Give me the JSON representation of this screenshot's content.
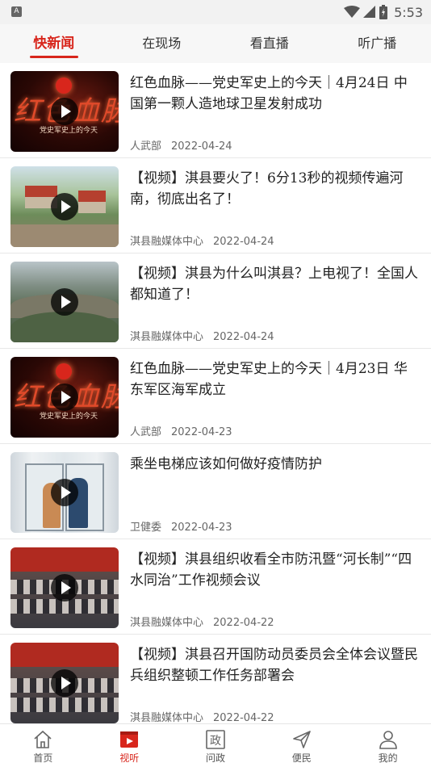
{
  "status_bar": {
    "left_icon": "A",
    "time": "5:53",
    "icons": [
      "wifi-icon",
      "signal-icon",
      "battery-icon"
    ]
  },
  "tabs": [
    {
      "label": "快新闻",
      "active": true
    },
    {
      "label": "在现场",
      "active": false
    },
    {
      "label": "看直播",
      "active": false
    },
    {
      "label": "听广播",
      "active": false
    }
  ],
  "news": [
    {
      "title": "红色血脉——党史军史上的今天｜4月24日 中国第一颗人造地球卫星发射成功",
      "source": "人武部",
      "date": "2022-04-24",
      "thumb_text": "红色血脉",
      "thumb_sub": "党史军史上的今天"
    },
    {
      "title": "【视频】淇县要火了！6分13秒的视频传遍河南，彻底出名了！",
      "source": "淇县融媒体中心",
      "date": "2022-04-24"
    },
    {
      "title": "【视频】淇县为什么叫淇县？上电视了！全国人都知道了！",
      "source": "淇县融媒体中心",
      "date": "2022-04-24"
    },
    {
      "title": "红色血脉——党史军史上的今天｜4月23日 华东军区海军成立",
      "source": "人武部",
      "date": "2022-04-23",
      "thumb_text": "红色血脉",
      "thumb_sub": "党史军史上的今天"
    },
    {
      "title": "乘坐电梯应该如何做好疫情防护",
      "source": "卫健委",
      "date": "2022-04-23"
    },
    {
      "title": "【视频】淇县组织收看全市防汛暨“河长制”“四水同治”工作视频会议",
      "source": "淇县融媒体中心",
      "date": "2022-04-22"
    },
    {
      "title": "【视频】淇县召开国防动员委员会全体会议暨民兵组织整顿工作任务部署会",
      "source": "淇县融媒体中心",
      "date": "2022-04-22"
    }
  ],
  "bottom_nav": [
    {
      "label": "首页",
      "icon": "home-icon",
      "active": false
    },
    {
      "label": "视听",
      "icon": "video-icon",
      "active": true
    },
    {
      "label": "问政",
      "icon": "zheng-icon",
      "icon_text": "政",
      "active": false
    },
    {
      "label": "便民",
      "icon": "send-icon",
      "active": false
    },
    {
      "label": "我的",
      "icon": "person-icon",
      "active": false
    }
  ],
  "colors": {
    "accent": "#d8261c",
    "tab_bar_bg": "#f7f7f7",
    "status_bar_bg": "#f2f2f2"
  }
}
